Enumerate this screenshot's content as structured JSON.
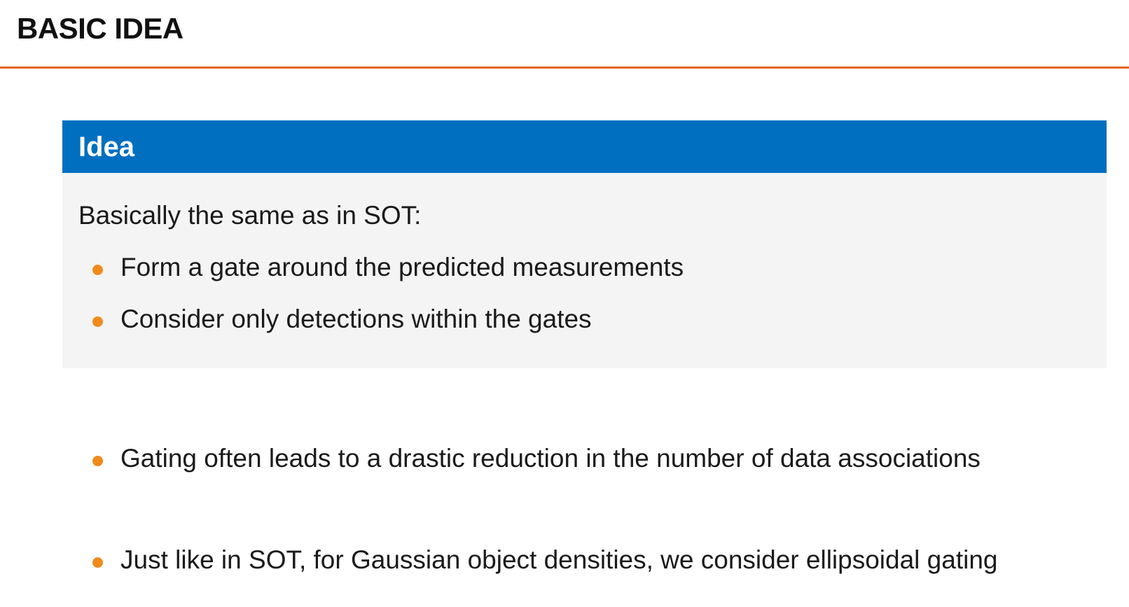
{
  "slide": {
    "title": "BASIC IDEA"
  },
  "block": {
    "header": "Idea",
    "intro": "Basically the same as in SOT:",
    "items": [
      "Form a gate around the predicted measurements",
      "Consider only detections within the gates"
    ]
  },
  "bullets": [
    "Gating often leads to a drastic reduction in the number of data associations",
    "Just like in SOT, for Gaussian object densities, we consider ellipsoidal gating"
  ],
  "colors": {
    "accent_rule": "#e8641e",
    "block_header": "#006fc0",
    "block_body": "#f4f4f4",
    "bullet": "#f08a1c"
  }
}
